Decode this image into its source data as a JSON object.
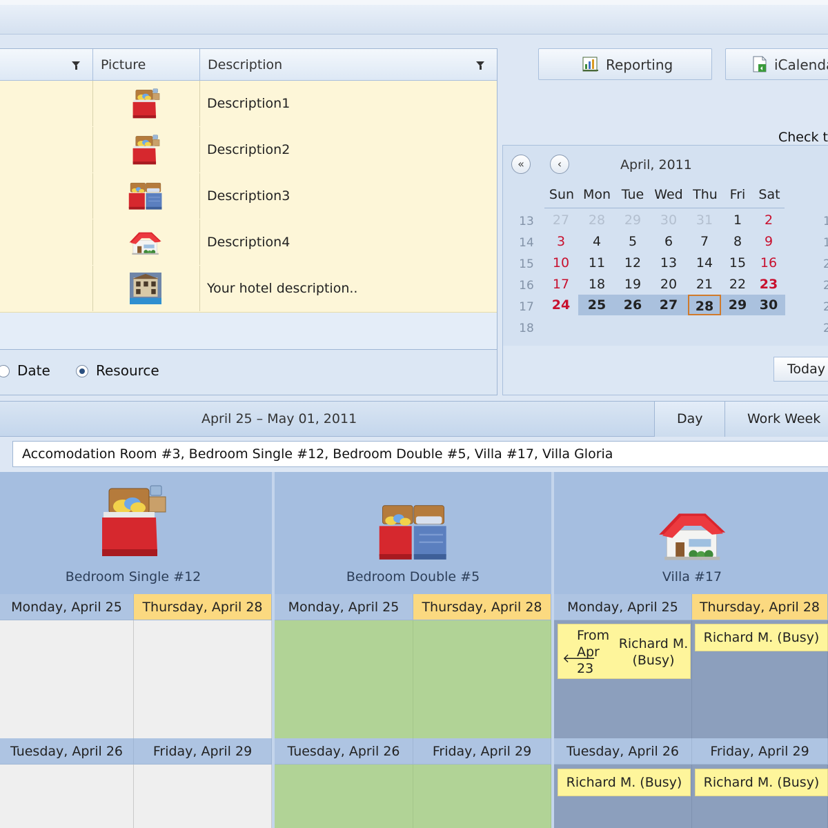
{
  "grid": {
    "columns": [
      {
        "label": "",
        "filterable": true
      },
      {
        "label": "Picture",
        "filterable": false
      },
      {
        "label": "Description",
        "filterable": true
      }
    ],
    "rows": [
      {
        "picture": "bedroom-single-icon",
        "description": "Description1"
      },
      {
        "picture": "bedroom-single-icon",
        "description": "Description2"
      },
      {
        "picture": "bedroom-double-icon",
        "description": "Description3"
      },
      {
        "picture": "villa-icon",
        "description": "Description4"
      },
      {
        "picture": "hotel-photo",
        "description": "Your hotel description.."
      }
    ]
  },
  "group_by": {
    "options": [
      {
        "label": "Date",
        "selected": false
      },
      {
        "label": "Resource",
        "selected": true
      }
    ]
  },
  "toolbar": {
    "reporting_label": "Reporting",
    "icalendar_label": "iCalendar"
  },
  "check_label": "Check t",
  "calendar": {
    "title": "April, 2011",
    "prev_year_label": "«",
    "prev_month_label": "‹",
    "weekdays": [
      "Sun",
      "Mon",
      "Tue",
      "Wed",
      "Thu",
      "Fri",
      "Sat"
    ],
    "week_numbers": [
      "13",
      "14",
      "15",
      "16",
      "17",
      "18"
    ],
    "weeks": [
      [
        "27",
        "28",
        "29",
        "30",
        "31",
        "1",
        "2"
      ],
      [
        "3",
        "4",
        "5",
        "6",
        "7",
        "8",
        "9"
      ],
      [
        "10",
        "11",
        "12",
        "13",
        "14",
        "15",
        "16"
      ],
      [
        "17",
        "18",
        "19",
        "20",
        "21",
        "22",
        "23"
      ],
      [
        "24",
        "25",
        "26",
        "27",
        "28",
        "29",
        "30"
      ]
    ],
    "today_button": "Today",
    "selected_day": "28"
  },
  "scheduler": {
    "date_range": "April 25 – May 01, 2011",
    "views": [
      "Day",
      "Work Week"
    ],
    "resources_text": "Accomodation Room #3, Bedroom Single #12, Bedroom Double #5, Villa #17, Villa Gloria",
    "resources": [
      {
        "name": "Bedroom Single #12",
        "icon": "bedroom-single-icon",
        "days": [
          {
            "label": "Monday, April 25",
            "status": "free"
          },
          {
            "label": "Thursday, April 28",
            "status": "free"
          },
          {
            "label": "Tuesday, April 26",
            "status": "free"
          },
          {
            "label": "Friday, April 29",
            "status": "free"
          }
        ]
      },
      {
        "name": "Bedroom Double #5",
        "icon": "bedroom-double-icon",
        "days": [
          {
            "label": "Monday, April 25",
            "status": "available"
          },
          {
            "label": "Thursday, April 28",
            "status": "available"
          },
          {
            "label": "Tuesday, April 26",
            "status": "available"
          },
          {
            "label": "Friday, April 29",
            "status": "available"
          }
        ]
      },
      {
        "name": "Villa #17",
        "icon": "villa-icon",
        "days": [
          {
            "label": "Monday, April 25",
            "status": "busy"
          },
          {
            "label": "Thursday, April 28",
            "status": "busy"
          },
          {
            "label": "Tuesday, April 26",
            "status": "busy"
          },
          {
            "label": "Friday, April 29",
            "status": "busy"
          }
        ]
      }
    ],
    "appointments": {
      "continued_from_line1": "From",
      "continued_from_line2": "Apr",
      "continued_from_line3": "23",
      "mon_subject_line1": "Richard M.",
      "mon_subject_line2": "(Busy)",
      "thu": "Richard M. (Busy)",
      "tue": "Richard M. (Busy)",
      "fri": "Richard M. (Busy)"
    },
    "highlight_color": "#fbd980",
    "available_color": "#b1d396",
    "busy_color": "#8c9fbd",
    "appointment_color": "#fef59b"
  }
}
